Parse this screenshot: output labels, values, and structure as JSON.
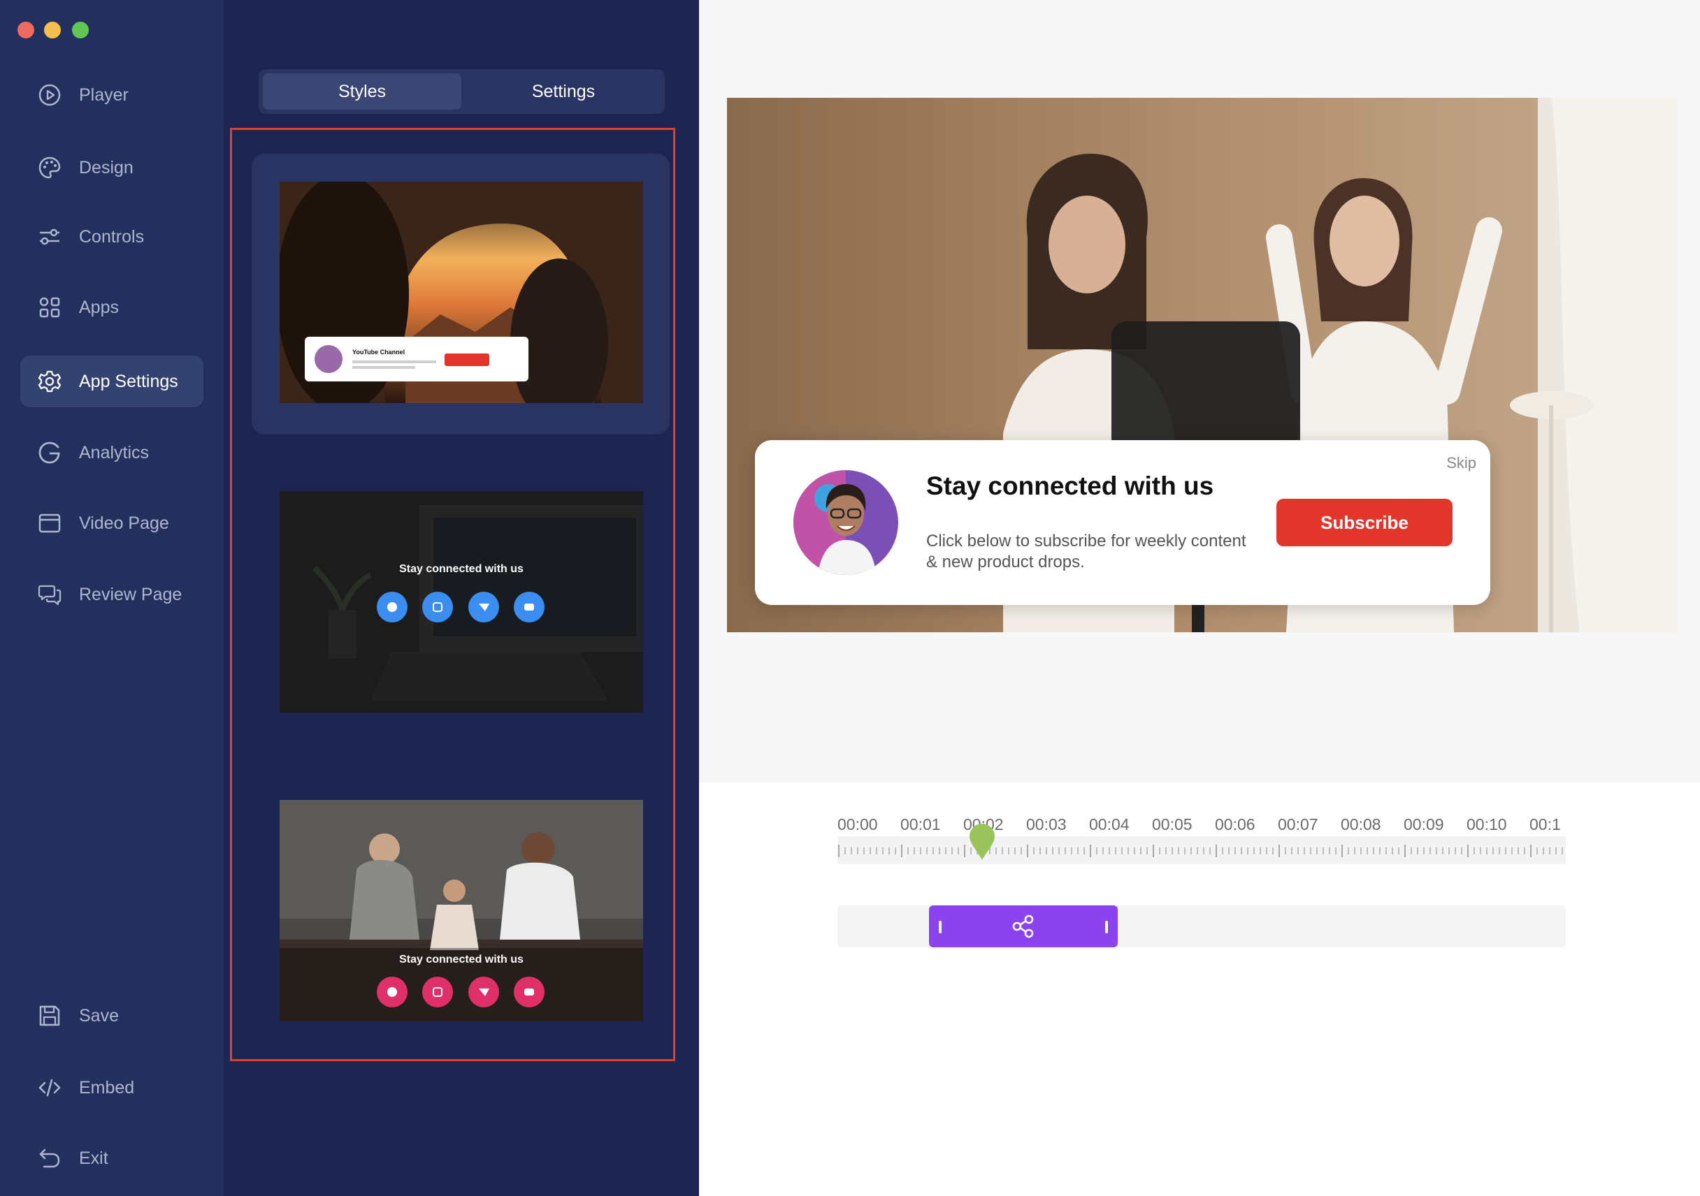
{
  "window": {
    "controls": [
      "close",
      "minimize",
      "zoom"
    ]
  },
  "nav": {
    "items": [
      {
        "label": "Player",
        "icon": "play-circle-icon"
      },
      {
        "label": "Design",
        "icon": "palette-icon"
      },
      {
        "label": "Controls",
        "icon": "sliders-icon"
      },
      {
        "label": "Apps",
        "icon": "apps-grid-icon"
      },
      {
        "label": "App Settings",
        "icon": "gear-icon",
        "active": true
      },
      {
        "label": "Analytics",
        "icon": "analytics-g-icon"
      },
      {
        "label": "Video Page",
        "icon": "browser-window-icon"
      },
      {
        "label": "Review Page",
        "icon": "chat-bubbles-icon"
      }
    ],
    "bottom": [
      {
        "label": "Save",
        "icon": "floppy-disk-icon"
      },
      {
        "label": "Embed",
        "icon": "code-icon"
      },
      {
        "label": "Exit",
        "icon": "exit-arrow-icon"
      }
    ]
  },
  "panel": {
    "tabs": [
      {
        "label": "Styles",
        "active": true
      },
      {
        "label": "Settings",
        "active": false
      }
    ],
    "styles": [
      {
        "caption": "YouTube Channel"
      },
      {
        "caption": "Stay connected with us"
      },
      {
        "caption": "Stay connected with us"
      }
    ]
  },
  "preview": {
    "popup": {
      "title": "Stay connected with us",
      "body": "Click below to subscribe for weekly content & new product drops.",
      "button": "Subscribe",
      "skip": "Skip"
    }
  },
  "timeline": {
    "labels": [
      "00:00",
      "00:01",
      "00:02",
      "00:03",
      "00:04",
      "00:05",
      "00:06",
      "00:07",
      "00:08",
      "00:09",
      "00:10",
      "00:1"
    ],
    "playhead_seconds": 2.3,
    "clip": {
      "start_seconds": 1.45,
      "end_seconds": 4.45,
      "icon": "share-icon"
    }
  },
  "colors": {
    "nav_bg": "#23305e",
    "panel_bg": "#1d2450",
    "highlight_border": "#e0402f",
    "subscribe_red": "#e2362c",
    "clip_purple": "#8b43f0",
    "playhead_green": "#9ac35c"
  }
}
